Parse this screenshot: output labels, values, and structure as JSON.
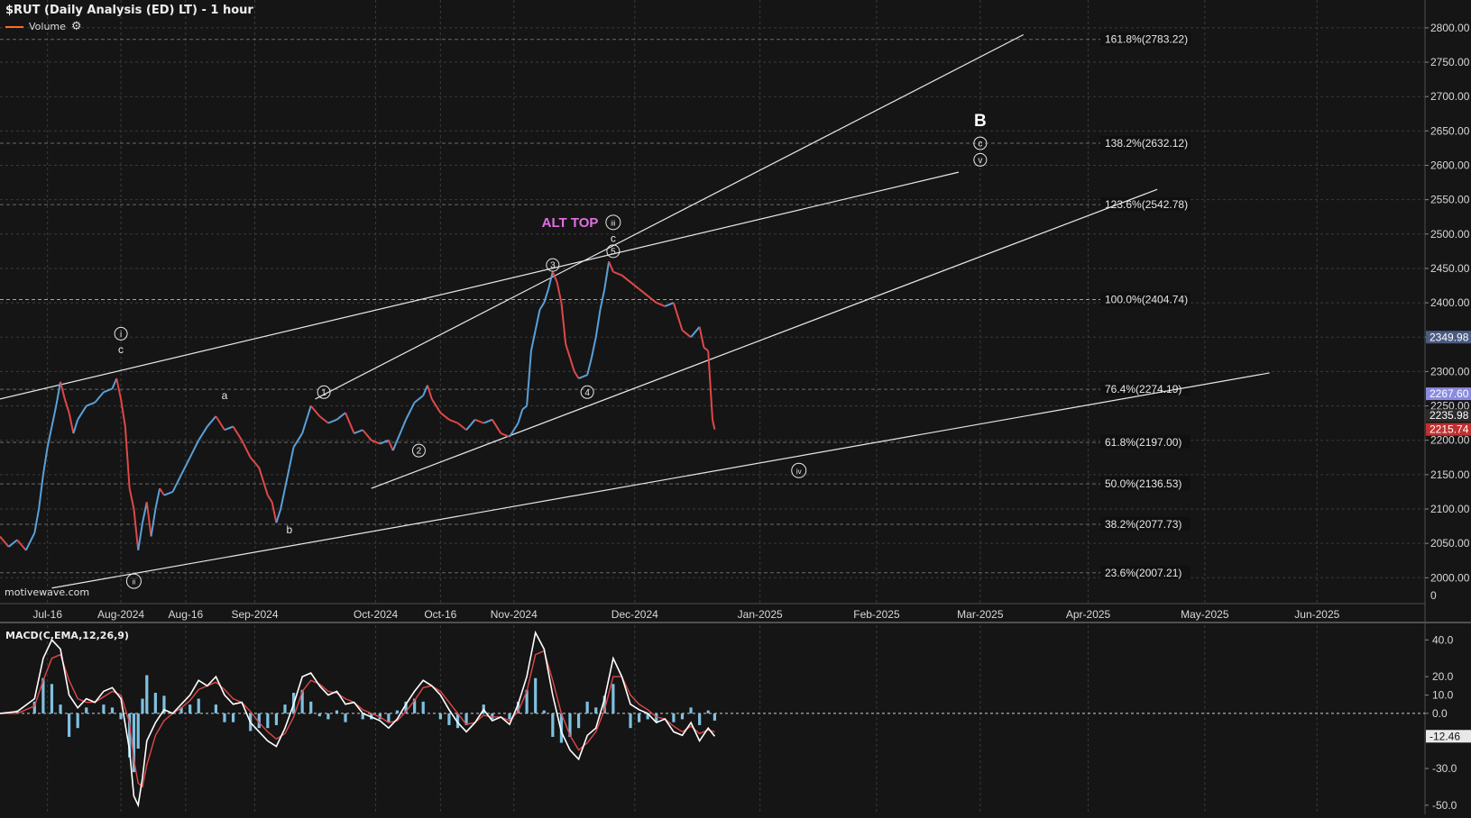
{
  "header": {
    "title": "$RUT (Daily Analysis (ED) LT) - 1 hour",
    "volume_label": "Volume",
    "settings_icon": "gear-icon"
  },
  "watermark": "motivewave.com",
  "colors": {
    "background": "#151515",
    "grid": "#3a3a3a",
    "axis_text": "#d8d8d8",
    "candle_up": "#5aa0d8",
    "candle_down": "#e04848",
    "trendline": "#e8e8e8",
    "fib_line": "#6a6a6a",
    "fib_100_line": "#b8b040",
    "alt_top": "#e070e0",
    "macd_line": "#ffffff",
    "macd_signal": "#e04848",
    "macd_hist": "#7fc0e0",
    "volume_swatch": "#ff6a2a"
  },
  "alt_top_label": "ALT TOP",
  "chart_data": {
    "type": "line",
    "x_axis_labels": [
      "Jul-16",
      "Aug-2024",
      "Aug-16",
      "Sep-2024",
      "Oct-2024",
      "Oct-16",
      "Nov-2024",
      "Dec-2024",
      "Jan-2025",
      "Feb-2025",
      "Mar-2025",
      "Apr-2025",
      "May-2025",
      "Jun-2025"
    ],
    "y_ticks": [
      "2000.00",
      "2050.00",
      "2100.00",
      "2150.00",
      "2200.00",
      "2250.00",
      "2300.00",
      "2350.00",
      "2400.00",
      "2450.00",
      "2500.00",
      "2550.00",
      "2600.00",
      "2650.00",
      "2700.00",
      "2750.00",
      "2800.00"
    ],
    "ylim": [
      1965,
      2830
    ],
    "price_tags": [
      {
        "label": "2349.98",
        "value": 2349.98,
        "color": "#4a5a80"
      },
      {
        "label": "2267.60",
        "value": 2267.6,
        "color": "#8a8ae0"
      },
      {
        "label": "2235.98",
        "value": 2235.98,
        "color": "#2a2a2a"
      },
      {
        "label": "2215.74",
        "value": 2215.74,
        "color": "#c03030"
      }
    ],
    "volume_axis_label": "0",
    "fib_levels": [
      {
        "label": "161.8%(2783.22)",
        "value": 2783.22
      },
      {
        "label": "138.2%(2632.12)",
        "value": 2632.12
      },
      {
        "label": "123.6%(2542.78)",
        "value": 2542.78
      },
      {
        "label": "100.0%(2404.74)",
        "value": 2404.74
      },
      {
        "label": "76.4%(2274.19)",
        "value": 2274.19
      },
      {
        "label": "61.8%(2197.00)",
        "value": 2197.0
      },
      {
        "label": "50.0%(2136.53)",
        "value": 2136.53
      },
      {
        "label": "38.2%(2077.73)",
        "value": 2077.73
      },
      {
        "label": "23.6%(2007.21)",
        "value": 2007.21
      }
    ],
    "price_series": [
      [
        0,
        2060
      ],
      [
        2,
        2045
      ],
      [
        4,
        2055
      ],
      [
        6,
        2040
      ],
      [
        8,
        2065
      ],
      [
        9,
        2100
      ],
      [
        10,
        2150
      ],
      [
        11,
        2190
      ],
      [
        12,
        2220
      ],
      [
        13,
        2250
      ],
      [
        14,
        2285
      ],
      [
        15,
        2260
      ],
      [
        16,
        2240
      ],
      [
        17,
        2210
      ],
      [
        18,
        2230
      ],
      [
        20,
        2250
      ],
      [
        22,
        2255
      ],
      [
        24,
        2270
      ],
      [
        26,
        2275
      ],
      [
        27,
        2290
      ],
      [
        28,
        2260
      ],
      [
        29,
        2220
      ],
      [
        30,
        2130
      ],
      [
        31,
        2100
      ],
      [
        32,
        2040
      ],
      [
        33,
        2080
      ],
      [
        34,
        2110
      ],
      [
        35,
        2060
      ],
      [
        36,
        2100
      ],
      [
        37,
        2130
      ],
      [
        38,
        2120
      ],
      [
        40,
        2125
      ],
      [
        42,
        2150
      ],
      [
        44,
        2175
      ],
      [
        46,
        2200
      ],
      [
        48,
        2220
      ],
      [
        50,
        2235
      ],
      [
        52,
        2215
      ],
      [
        54,
        2220
      ],
      [
        56,
        2200
      ],
      [
        58,
        2175
      ],
      [
        60,
        2160
      ],
      [
        62,
        2120
      ],
      [
        63,
        2110
      ],
      [
        64,
        2080
      ],
      [
        65,
        2100
      ],
      [
        66,
        2130
      ],
      [
        67,
        2160
      ],
      [
        68,
        2190
      ],
      [
        70,
        2210
      ],
      [
        71,
        2230
      ],
      [
        72,
        2250
      ],
      [
        74,
        2235
      ],
      [
        76,
        2225
      ],
      [
        78,
        2230
      ],
      [
        80,
        2240
      ],
      [
        82,
        2210
      ],
      [
        84,
        2215
      ],
      [
        86,
        2200
      ],
      [
        88,
        2195
      ],
      [
        90,
        2200
      ],
      [
        91,
        2185
      ],
      [
        92,
        2200
      ],
      [
        93,
        2215
      ],
      [
        94,
        2230
      ],
      [
        96,
        2255
      ],
      [
        98,
        2265
      ],
      [
        99,
        2280
      ],
      [
        100,
        2260
      ],
      [
        102,
        2240
      ],
      [
        104,
        2230
      ],
      [
        106,
        2225
      ],
      [
        108,
        2215
      ],
      [
        110,
        2230
      ],
      [
        112,
        2225
      ],
      [
        114,
        2230
      ],
      [
        116,
        2210
      ],
      [
        118,
        2205
      ],
      [
        120,
        2225
      ],
      [
        121,
        2245
      ],
      [
        122,
        2250
      ],
      [
        123,
        2330
      ],
      [
        124,
        2360
      ],
      [
        125,
        2390
      ],
      [
        126,
        2400
      ],
      [
        127,
        2420
      ],
      [
        128,
        2445
      ],
      [
        129,
        2430
      ],
      [
        130,
        2400
      ],
      [
        131,
        2340
      ],
      [
        132,
        2320
      ],
      [
        133,
        2300
      ],
      [
        134,
        2290
      ],
      [
        136,
        2295
      ],
      [
        137,
        2320
      ],
      [
        138,
        2350
      ],
      [
        139,
        2390
      ],
      [
        140,
        2420
      ],
      [
        141,
        2460
      ],
      [
        142,
        2445
      ],
      [
        144,
        2440
      ],
      [
        146,
        2430
      ],
      [
        148,
        2420
      ],
      [
        150,
        2410
      ],
      [
        152,
        2400
      ],
      [
        154,
        2395
      ],
      [
        156,
        2400
      ],
      [
        158,
        2360
      ],
      [
        160,
        2350
      ],
      [
        162,
        2365
      ],
      [
        163,
        2335
      ],
      [
        164,
        2330
      ],
      [
        165,
        2230
      ],
      [
        165.5,
        2215.74
      ]
    ],
    "x_axis_map": {
      "Jul-16": 11,
      "Aug-2024": 28,
      "Aug-16": 43,
      "Sep-2024": 59,
      "Oct-2024": 87,
      "Oct-16": 102,
      "Nov-2024": 119,
      "Dec-2024": 147,
      "Jan-2025": 176,
      "Feb-2025": 203,
      "Mar-2025": 227,
      "Apr-2025": 252,
      "May-2025": 279,
      "Jun-2025": 305
    },
    "wave_labels": [
      {
        "text": "i",
        "x": 28,
        "y": 2355,
        "circled": true
      },
      {
        "text": "c",
        "x": 28,
        "y": 2332,
        "circled": false
      },
      {
        "text": "ii",
        "x": 31,
        "y": 1995,
        "circled": true
      },
      {
        "text": "a",
        "x": 52,
        "y": 2265,
        "circled": false
      },
      {
        "text": "b",
        "x": 67,
        "y": 2070,
        "circled": false
      },
      {
        "text": "1",
        "x": 75,
        "y": 2270,
        "circled": true
      },
      {
        "text": "2",
        "x": 97,
        "y": 2185,
        "circled": true
      },
      {
        "text": "3",
        "x": 128,
        "y": 2455,
        "circled": true
      },
      {
        "text": "4",
        "x": 136,
        "y": 2270,
        "circled": true
      },
      {
        "text": "5",
        "x": 142,
        "y": 2475,
        "circled": true
      },
      {
        "text": "c",
        "x": 142,
        "y": 2494,
        "circled": false
      },
      {
        "text": "iii",
        "x": 142,
        "y": 2517,
        "circled": true
      },
      {
        "text": "iv",
        "x": 185,
        "y": 2156,
        "circled": true
      },
      {
        "text": "B",
        "x": 227,
        "y": 2666,
        "circled": false
      },
      {
        "text": "c",
        "x": 227,
        "y": 2632,
        "circled": true
      },
      {
        "text": "v",
        "x": 227,
        "y": 2608,
        "circled": true
      }
    ],
    "trendlines": [
      [
        [
          0,
          2260
        ],
        [
          222,
          2590
        ]
      ],
      [
        [
          73,
          2260
        ],
        [
          237,
          2790
        ]
      ],
      [
        [
          86,
          2130
        ],
        [
          268,
          2565
        ]
      ],
      [
        [
          12,
          1985
        ],
        [
          294,
          2298
        ]
      ]
    ],
    "macd": {
      "label": "MACD(C,EMA,12,26,9)",
      "y_ticks": [
        "40.0",
        "20.0",
        "10.0",
        "0.0",
        "-12.46",
        "-30.0",
        "-50.0"
      ],
      "ylim": [
        -55,
        48
      ],
      "series": [
        [
          0,
          0
        ],
        [
          4,
          1
        ],
        [
          8,
          8
        ],
        [
          10,
          30
        ],
        [
          12,
          40
        ],
        [
          14,
          35
        ],
        [
          16,
          10
        ],
        [
          18,
          3
        ],
        [
          20,
          8
        ],
        [
          22,
          6
        ],
        [
          24,
          12
        ],
        [
          26,
          14
        ],
        [
          28,
          8
        ],
        [
          30,
          -20
        ],
        [
          31,
          -45
        ],
        [
          32,
          -50
        ],
        [
          33,
          -35
        ],
        [
          34,
          -15
        ],
        [
          36,
          -5
        ],
        [
          38,
          2
        ],
        [
          40,
          0
        ],
        [
          42,
          5
        ],
        [
          44,
          10
        ],
        [
          46,
          18
        ],
        [
          48,
          15
        ],
        [
          50,
          20
        ],
        [
          52,
          10
        ],
        [
          54,
          5
        ],
        [
          56,
          6
        ],
        [
          58,
          -5
        ],
        [
          60,
          -10
        ],
        [
          62,
          -15
        ],
        [
          64,
          -18
        ],
        [
          66,
          -8
        ],
        [
          68,
          5
        ],
        [
          70,
          20
        ],
        [
          72,
          22
        ],
        [
          74,
          15
        ],
        [
          76,
          10
        ],
        [
          78,
          12
        ],
        [
          80,
          5
        ],
        [
          82,
          6
        ],
        [
          84,
          0
        ],
        [
          86,
          -2
        ],
        [
          88,
          -4
        ],
        [
          90,
          -8
        ],
        [
          92,
          -3
        ],
        [
          94,
          5
        ],
        [
          96,
          12
        ],
        [
          98,
          18
        ],
        [
          100,
          15
        ],
        [
          102,
          10
        ],
        [
          104,
          2
        ],
        [
          106,
          -5
        ],
        [
          108,
          -10
        ],
        [
          110,
          -5
        ],
        [
          112,
          2
        ],
        [
          114,
          -4
        ],
        [
          116,
          -2
        ],
        [
          118,
          -6
        ],
        [
          120,
          5
        ],
        [
          122,
          20
        ],
        [
          124,
          44
        ],
        [
          126,
          35
        ],
        [
          128,
          10
        ],
        [
          130,
          -10
        ],
        [
          132,
          -20
        ],
        [
          134,
          -25
        ],
        [
          136,
          -12
        ],
        [
          138,
          -8
        ],
        [
          140,
          8
        ],
        [
          142,
          30
        ],
        [
          144,
          20
        ],
        [
          146,
          5
        ],
        [
          148,
          2
        ],
        [
          150,
          0
        ],
        [
          152,
          -5
        ],
        [
          154,
          -3
        ],
        [
          156,
          -10
        ],
        [
          158,
          -12
        ],
        [
          160,
          -5
        ],
        [
          162,
          -15
        ],
        [
          164,
          -8
        ],
        [
          165.5,
          -12.46
        ]
      ],
      "signal": [
        [
          0,
          0
        ],
        [
          4,
          0
        ],
        [
          8,
          4
        ],
        [
          10,
          18
        ],
        [
          12,
          30
        ],
        [
          14,
          32
        ],
        [
          16,
          18
        ],
        [
          18,
          8
        ],
        [
          20,
          6
        ],
        [
          22,
          6
        ],
        [
          24,
          9
        ],
        [
          26,
          12
        ],
        [
          28,
          10
        ],
        [
          30,
          -5
        ],
        [
          31,
          -25
        ],
        [
          32,
          -38
        ],
        [
          33,
          -40
        ],
        [
          34,
          -28
        ],
        [
          36,
          -12
        ],
        [
          38,
          -4
        ],
        [
          40,
          0
        ],
        [
          42,
          3
        ],
        [
          44,
          7
        ],
        [
          46,
          13
        ],
        [
          48,
          15
        ],
        [
          50,
          17
        ],
        [
          52,
          13
        ],
        [
          54,
          8
        ],
        [
          56,
          6
        ],
        [
          58,
          1
        ],
        [
          60,
          -5
        ],
        [
          62,
          -10
        ],
        [
          64,
          -14
        ],
        [
          66,
          -11
        ],
        [
          68,
          -2
        ],
        [
          70,
          12
        ],
        [
          72,
          18
        ],
        [
          74,
          16
        ],
        [
          76,
          12
        ],
        [
          78,
          11
        ],
        [
          80,
          8
        ],
        [
          82,
          6
        ],
        [
          84,
          2
        ],
        [
          86,
          0
        ],
        [
          88,
          -2
        ],
        [
          90,
          -5
        ],
        [
          92,
          -4
        ],
        [
          94,
          1
        ],
        [
          96,
          7
        ],
        [
          98,
          14
        ],
        [
          100,
          15
        ],
        [
          102,
          12
        ],
        [
          104,
          6
        ],
        [
          106,
          0
        ],
        [
          108,
          -6
        ],
        [
          110,
          -5
        ],
        [
          112,
          -1
        ],
        [
          114,
          -2
        ],
        [
          116,
          -2
        ],
        [
          118,
          -4
        ],
        [
          120,
          1
        ],
        [
          122,
          12
        ],
        [
          124,
          32
        ],
        [
          126,
          34
        ],
        [
          128,
          18
        ],
        [
          130,
          0
        ],
        [
          132,
          -12
        ],
        [
          134,
          -20
        ],
        [
          136,
          -16
        ],
        [
          138,
          -10
        ],
        [
          140,
          2
        ],
        [
          142,
          20
        ],
        [
          144,
          20
        ],
        [
          146,
          10
        ],
        [
          148,
          5
        ],
        [
          150,
          2
        ],
        [
          152,
          -2
        ],
        [
          154,
          -3
        ],
        [
          156,
          -7
        ],
        [
          158,
          -10
        ],
        [
          160,
          -7
        ],
        [
          162,
          -11
        ],
        [
          164,
          -9
        ],
        [
          165.5,
          -10
        ]
      ]
    }
  }
}
